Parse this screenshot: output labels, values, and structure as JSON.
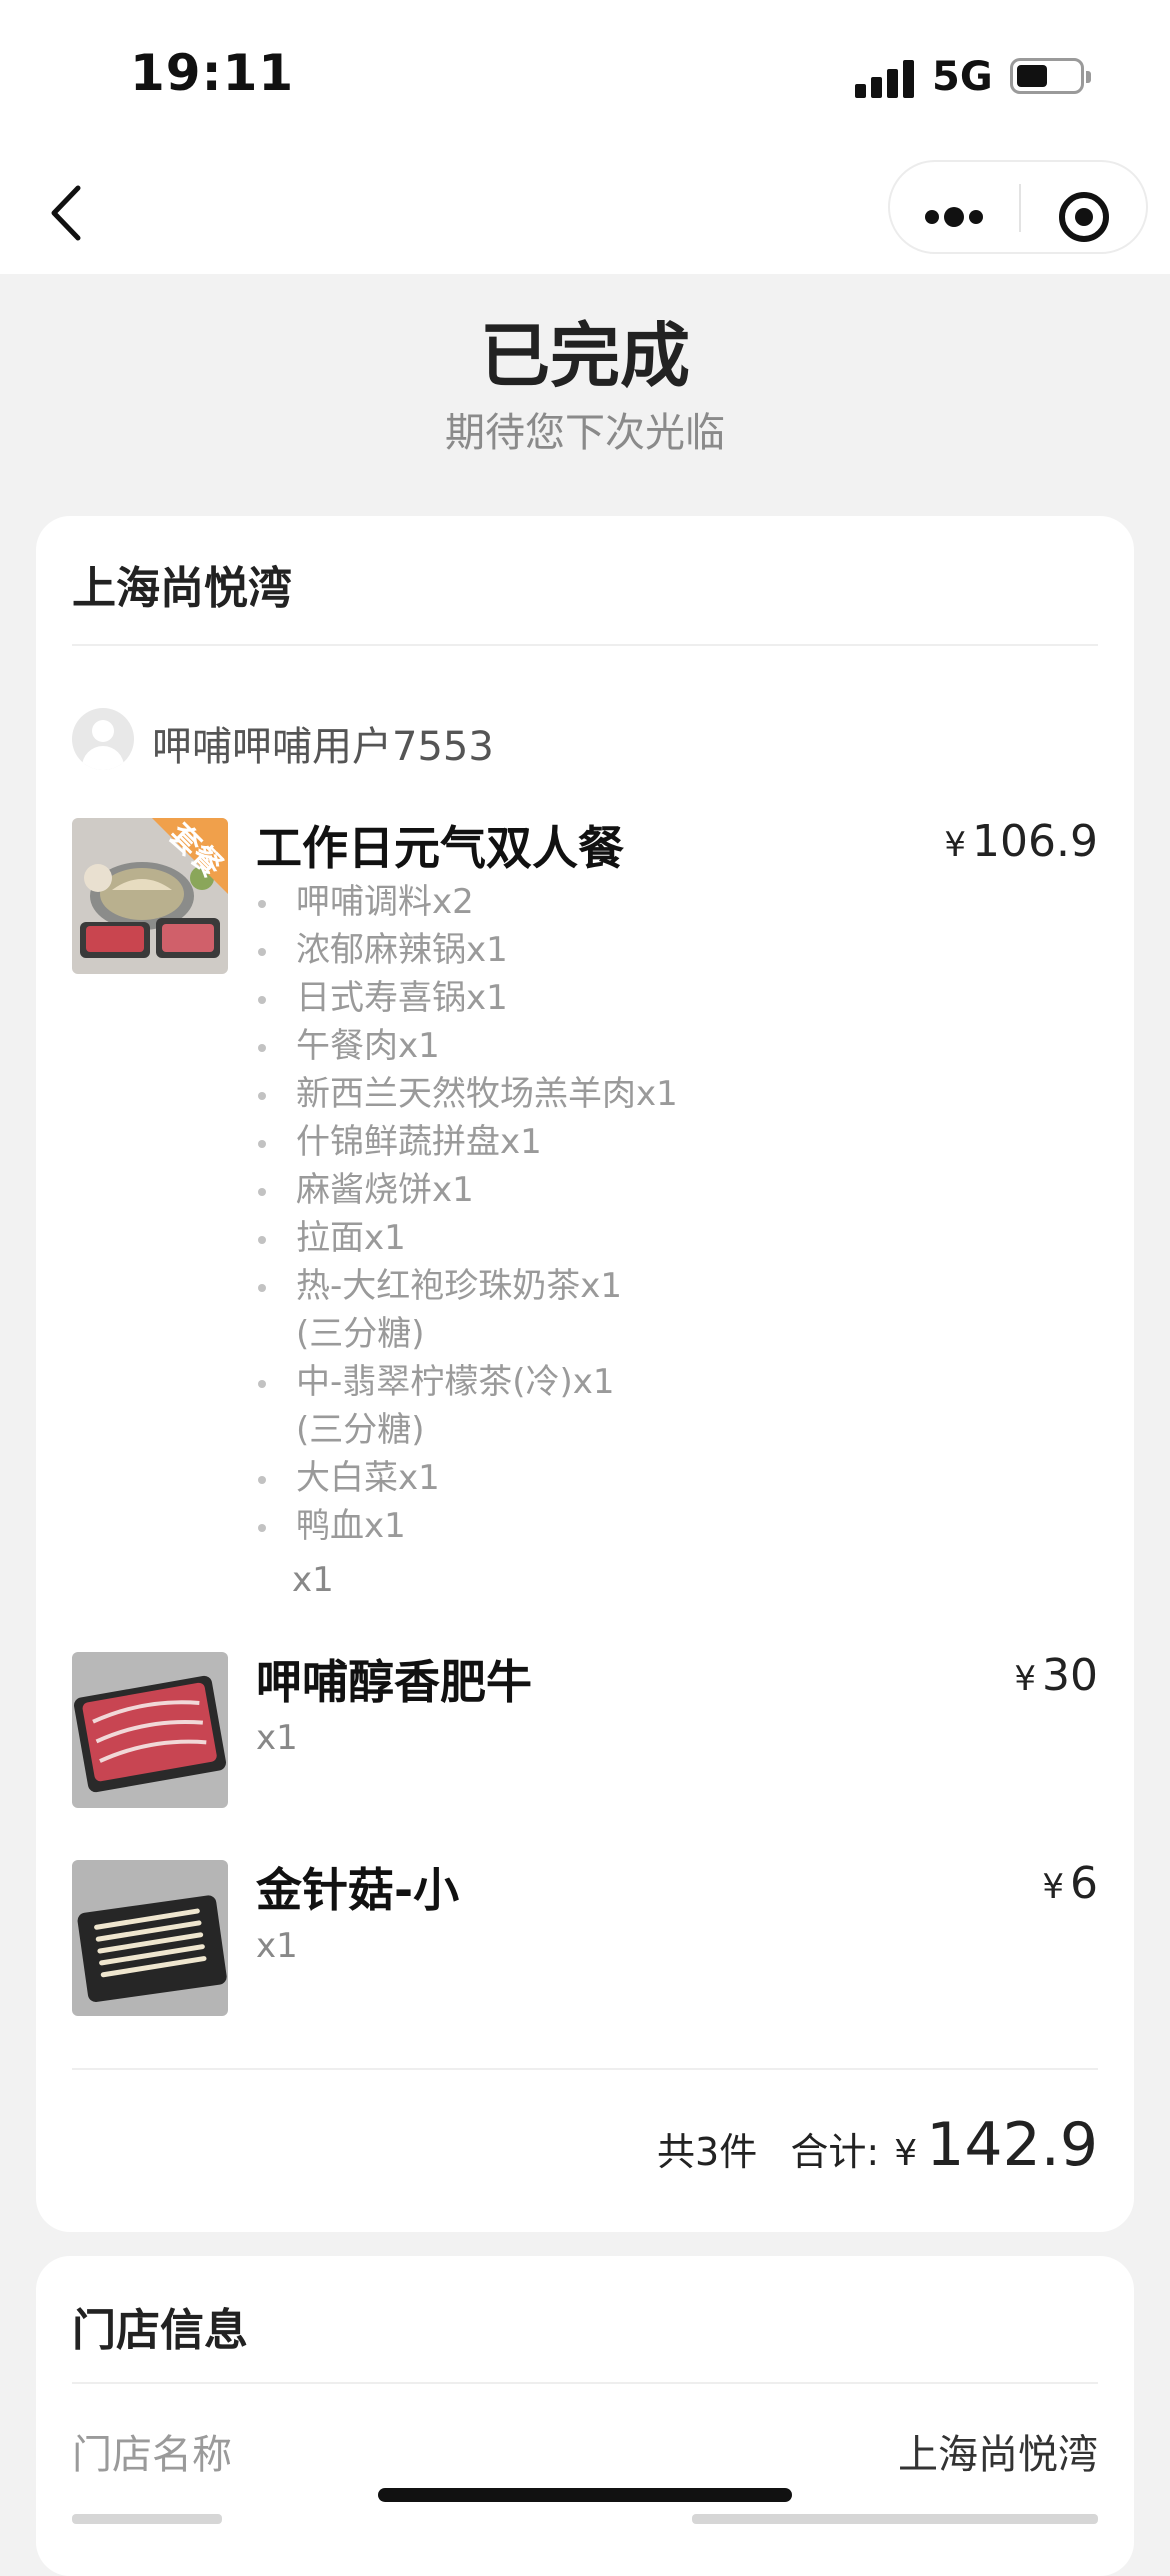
{
  "status_bar": {
    "time": "19:11",
    "network": "5G",
    "battery_percent": 45
  },
  "nav": {
    "back_icon": "chevron-left-icon",
    "more_icon": "more-dots-icon",
    "close_icon": "target-circle-icon"
  },
  "header": {
    "title": "已完成",
    "subtitle": "期待您下次光临"
  },
  "order": {
    "store_name": "上海尚悦湾",
    "user_name": "呷哺呷哺用户7553",
    "items": [
      {
        "name": "工作日元气双人餐",
        "currency": "¥",
        "price": "106.9",
        "badge": "套餐",
        "quantity": "x1",
        "sub_items": [
          {
            "text": "呷哺调料x2"
          },
          {
            "text": "浓郁麻辣锅x1"
          },
          {
            "text": "日式寿喜锅x1"
          },
          {
            "text": "午餐肉x1"
          },
          {
            "text": "新西兰天然牧场羔羊肉x1"
          },
          {
            "text": "什锦鲜蔬拼盘x1"
          },
          {
            "text": "麻酱烧饼x1"
          },
          {
            "text": "拉面x1"
          },
          {
            "text": "热-大红袍珍珠奶茶x1",
            "note": "(三分糖)"
          },
          {
            "text": "中-翡翠柠檬茶(冷)x1",
            "note": "(三分糖)"
          },
          {
            "text": "大白菜x1"
          },
          {
            "text": "鸭血x1"
          }
        ]
      },
      {
        "name": "呷哺醇香肥牛",
        "currency": "¥",
        "price": "30",
        "quantity": "x1"
      },
      {
        "name": "金针菇-小",
        "currency": "¥",
        "price": "6",
        "quantity": "x1"
      }
    ],
    "summary": {
      "count": "共3件",
      "total_label": "合计:",
      "currency": "¥",
      "total": "142.9"
    }
  },
  "store_info": {
    "title": "门店信息",
    "rows": [
      {
        "label": "门店名称",
        "value": "上海尚悦湾"
      }
    ]
  },
  "colors": {
    "background": "#f2f2f2",
    "card": "#ffffff",
    "badge": "#f0a04b",
    "text_primary": "#111111",
    "text_secondary": "#9a9a9a"
  }
}
